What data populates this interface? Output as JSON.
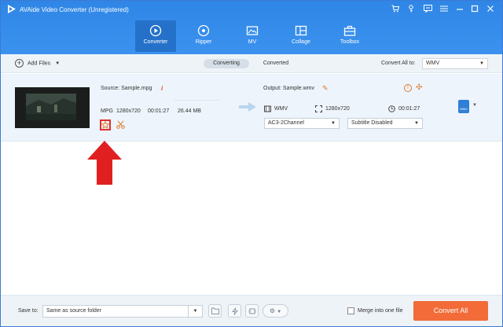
{
  "app": {
    "title": "AVAide Video Converter (Unregistered)"
  },
  "window_controls": [
    "cart-icon",
    "key-icon",
    "feedback-icon",
    "menu-icon",
    "minimize-icon",
    "maximize-icon",
    "close-icon"
  ],
  "nav": {
    "items": [
      {
        "label": "Converter",
        "icon": "converter-icon",
        "active": true
      },
      {
        "label": "Ripper",
        "icon": "ripper-icon",
        "active": false
      },
      {
        "label": "MV",
        "icon": "mv-icon",
        "active": false
      },
      {
        "label": "Collage",
        "icon": "collage-icon",
        "active": false
      },
      {
        "label": "Toolbox",
        "icon": "toolbox-icon",
        "active": false
      }
    ]
  },
  "toolbar": {
    "add_files": "Add Files",
    "tabs": [
      {
        "label": "Converting",
        "active": true
      },
      {
        "label": "Converted",
        "active": false
      }
    ],
    "convert_all_label": "Convert All to:",
    "convert_all_value": "WMV"
  },
  "file": {
    "source": "Source: Sample.mpg",
    "format": "MPG",
    "resolution": "1280x720",
    "duration": "00:01:27",
    "size": "26.44 MB",
    "output": "Output: Sample.wmv",
    "out_format": "WMV",
    "out_resolution": "1280x720",
    "out_duration": "00:01:27",
    "audio": "AC3-2Channel",
    "subtitle": "Subtitle Disabled",
    "badge_text": "WMV"
  },
  "bottom": {
    "save_to_label": "Save to:",
    "save_to_value": "Same as source folder",
    "merge_label": "Merge into one file",
    "merge_checked": false,
    "convert_all_button": "Convert All"
  },
  "colors": {
    "header_blue": "#3b8fea",
    "accent_orange": "#f26b38",
    "annotation_red": "#e02020"
  }
}
